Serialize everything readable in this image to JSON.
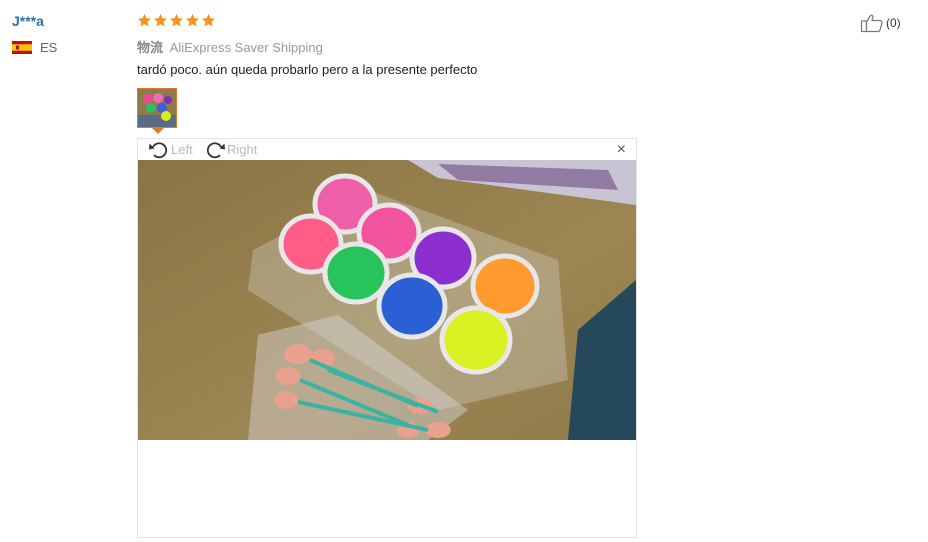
{
  "reviewer": {
    "name": "J***a",
    "country_code": "ES"
  },
  "review": {
    "rating": 5,
    "rating_max": 5,
    "logistics_label": "物流",
    "shipping_method": "AliExpress Saver Shipping",
    "text": "tardó poco. aún queda probarlo pero a la presente perfecto"
  },
  "helpful": {
    "count_text": "(0)",
    "icon": "thumbs-up-icon"
  },
  "viewer": {
    "rotate_left_label": "Left",
    "rotate_right_label": "Right",
    "close_label": "×"
  },
  "colors": {
    "name_blue": "#2c6fa8",
    "star_orange": "#f7931e",
    "thumb_border": "#e07a2b"
  }
}
